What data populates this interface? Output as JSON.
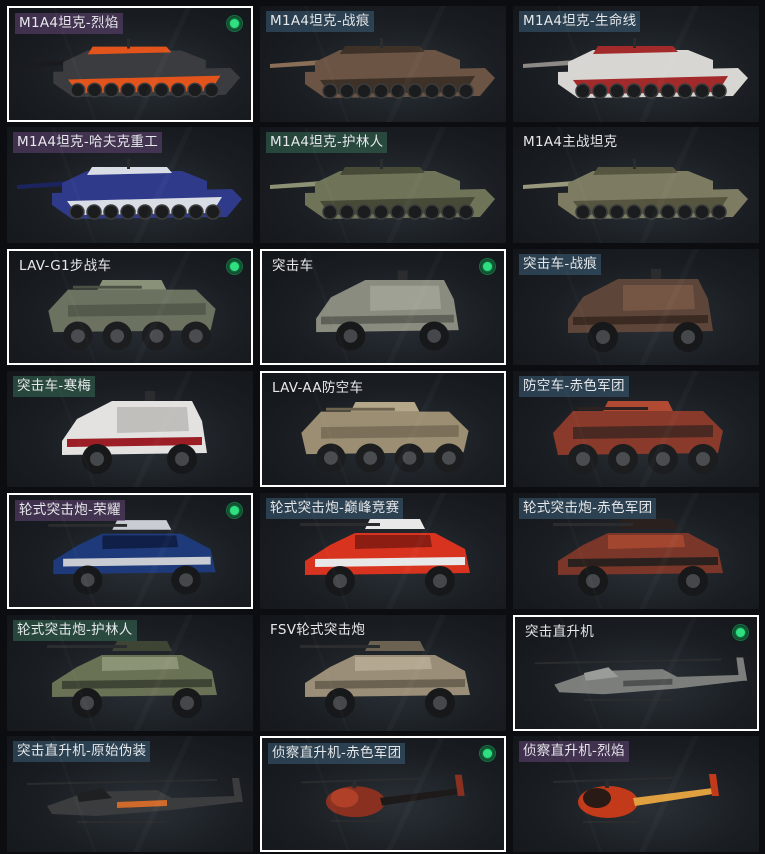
{
  "cards": [
    {
      "label": "M1A4坦克-烈焰",
      "tag": "purple",
      "selected": true,
      "equipped": true,
      "kind": "tank",
      "palette": [
        "#3a3c40",
        "#e2541c",
        "#1a1b1e"
      ]
    },
    {
      "label": "M1A4坦克-战痕",
      "tag": "blue",
      "selected": false,
      "equipped": false,
      "kind": "tank",
      "palette": [
        "#6b5444",
        "#3d3128",
        "#8a6e58"
      ]
    },
    {
      "label": "M1A4坦克-生命线",
      "tag": "blue",
      "selected": false,
      "equipped": false,
      "kind": "tank",
      "palette": [
        "#d8d6d2",
        "#a32a2a",
        "#8d8a86"
      ]
    },
    {
      "label": "M1A4坦克-哈夫克重工",
      "tag": "purple",
      "selected": false,
      "equipped": false,
      "kind": "tank",
      "palette": [
        "#2f3a8a",
        "#d9dde6",
        "#1c2460"
      ]
    },
    {
      "label": "M1A4坦克-护林人",
      "tag": "green",
      "selected": false,
      "equipped": false,
      "kind": "tank",
      "palette": [
        "#6f7458",
        "#464a37",
        "#8e9275"
      ]
    },
    {
      "label": "M1A4主战坦克",
      "tag": "none",
      "selected": false,
      "equipped": false,
      "kind": "tank",
      "palette": [
        "#7d7c62",
        "#56553f",
        "#9a987c"
      ]
    },
    {
      "label": "LAV-G1步战车",
      "tag": "none",
      "selected": true,
      "equipped": true,
      "kind": "apc",
      "palette": [
        "#6b7260",
        "#4b5144",
        "#8a9179"
      ]
    },
    {
      "label": "突击车",
      "tag": "none",
      "selected": true,
      "equipped": true,
      "kind": "mrap",
      "palette": [
        "#8b8c80",
        "#5f6158",
        "#a5a69a"
      ]
    },
    {
      "label": "突击车-战痕",
      "tag": "blue",
      "selected": false,
      "equipped": false,
      "kind": "mrap",
      "palette": [
        "#5e4539",
        "#3a2a22",
        "#7a5a48"
      ]
    },
    {
      "label": "突击车-寒梅",
      "tag": "green",
      "selected": false,
      "equipped": false,
      "kind": "mrap",
      "palette": [
        "#e3e2e0",
        "#9b1d25",
        "#b8b6b2"
      ]
    },
    {
      "label": "LAV-AA防空车",
      "tag": "none",
      "selected": true,
      "equipped": false,
      "kind": "apc",
      "palette": [
        "#9c8e72",
        "#6e634f",
        "#b5a78a"
      ]
    },
    {
      "label": "防空车-赤色军团",
      "tag": "blue",
      "selected": false,
      "equipped": false,
      "kind": "apc",
      "palette": [
        "#8a3a2a",
        "#2e2220",
        "#b04a32"
      ]
    },
    {
      "label": "轮式突击炮-荣耀",
      "tag": "purple",
      "selected": true,
      "equipped": true,
      "kind": "jeep",
      "palette": [
        "#1e3a7a",
        "#c9ccd3",
        "#0f1f48"
      ]
    },
    {
      "label": "轮式突击炮-巅峰竞赛",
      "tag": "blue",
      "selected": false,
      "equipped": false,
      "kind": "jeep",
      "palette": [
        "#d7331f",
        "#e8e8e8",
        "#8c1d12"
      ]
    },
    {
      "label": "轮式突击炮-赤色军团",
      "tag": "blue",
      "selected": false,
      "equipped": false,
      "kind": "jeep",
      "palette": [
        "#7a3628",
        "#2a211e",
        "#a34630"
      ]
    },
    {
      "label": "轮式突击炮-护林人",
      "tag": "green",
      "selected": false,
      "equipped": false,
      "kind": "jeep",
      "palette": [
        "#6a7256",
        "#3f4535",
        "#8c9476"
      ]
    },
    {
      "label": "FSV轮式突击炮",
      "tag": "none",
      "selected": false,
      "equipped": false,
      "kind": "jeep",
      "palette": [
        "#9a8e78",
        "#6b6252",
        "#b3a890"
      ]
    },
    {
      "label": "突击直升机",
      "tag": "none",
      "selected": true,
      "equipped": true,
      "kind": "heli",
      "palette": [
        "#7c7e7c",
        "#4f5150",
        "#9a9c9a"
      ]
    },
    {
      "label": "突击直升机-原始伪装",
      "tag": "blue",
      "selected": false,
      "equipped": false,
      "kind": "heli",
      "palette": [
        "#3a3c3e",
        "#d06a2a",
        "#1e2022"
      ]
    },
    {
      "label": "侦察直升机-赤色军团",
      "tag": "blue",
      "selected": true,
      "equipped": true,
      "kind": "scout",
      "palette": [
        "#8a3020",
        "#1e1a1a",
        "#b04028"
      ]
    },
    {
      "label": "侦察直升机-烈焰",
      "tag": "purple",
      "selected": false,
      "equipped": false,
      "kind": "scout",
      "palette": [
        "#c23a1a",
        "#e0a040",
        "#2a1a16"
      ]
    }
  ]
}
